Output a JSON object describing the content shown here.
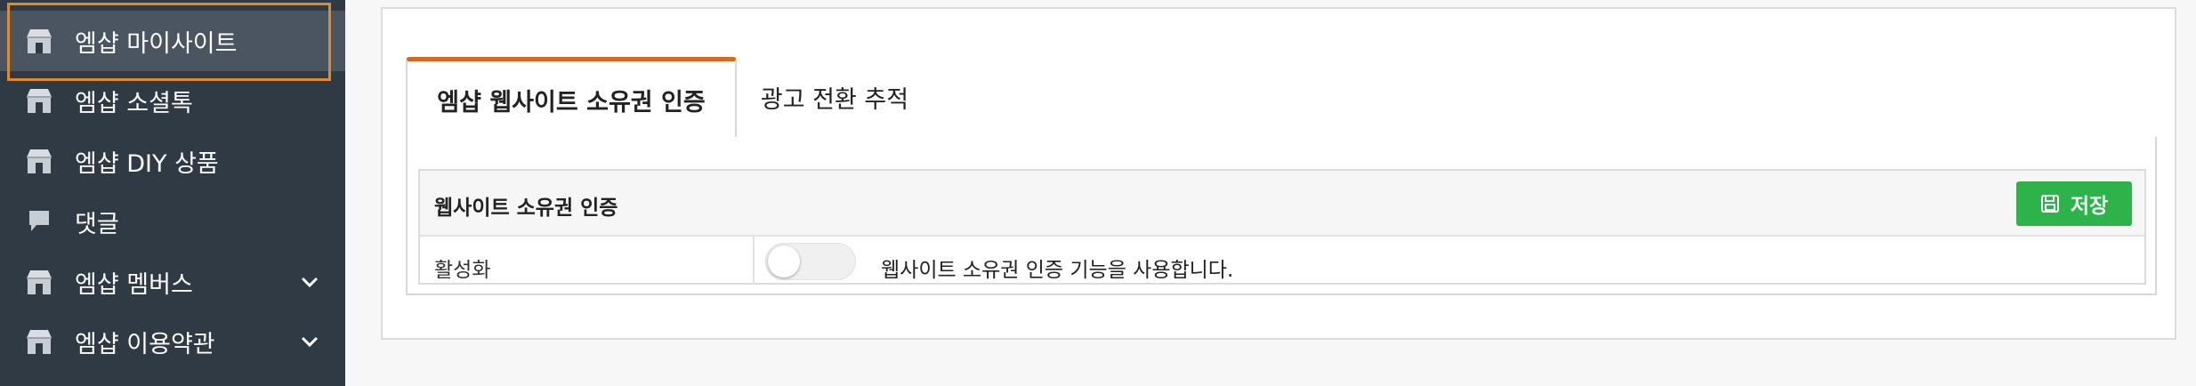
{
  "sidebar": {
    "items": [
      {
        "label": "엠샵 마이사이트",
        "icon": "shop-icon",
        "active": true,
        "has_submenu": false
      },
      {
        "label": "엠샵 소셜톡",
        "icon": "shop-icon",
        "active": false,
        "has_submenu": false
      },
      {
        "label": "엠샵 DIY 상품",
        "icon": "shop-icon",
        "active": false,
        "has_submenu": false
      },
      {
        "label": "댓글",
        "icon": "comment-icon",
        "active": false,
        "has_submenu": false
      },
      {
        "label": "엠샵 멤버스",
        "icon": "shop-icon",
        "active": false,
        "has_submenu": true
      },
      {
        "label": "엠샵 이용약관",
        "icon": "shop-icon",
        "active": false,
        "has_submenu": true
      }
    ]
  },
  "tabs": [
    {
      "label": "엠샵 웹사이트 소유권 인증",
      "active": true
    },
    {
      "label": "광고 전환 추적",
      "active": false
    }
  ],
  "section": {
    "title": "웹사이트 소유권 인증",
    "save_label": "저장",
    "row": {
      "label": "활성화",
      "toggle_on": false,
      "description": "웹사이트 소유권 인증 기능을 사용합니다."
    }
  },
  "colors": {
    "sidebar_bg": "#2f3a44",
    "active_tab_accent": "#d26a22",
    "save_button": "#2eb34a",
    "focus_outline": "#e08a2e"
  }
}
